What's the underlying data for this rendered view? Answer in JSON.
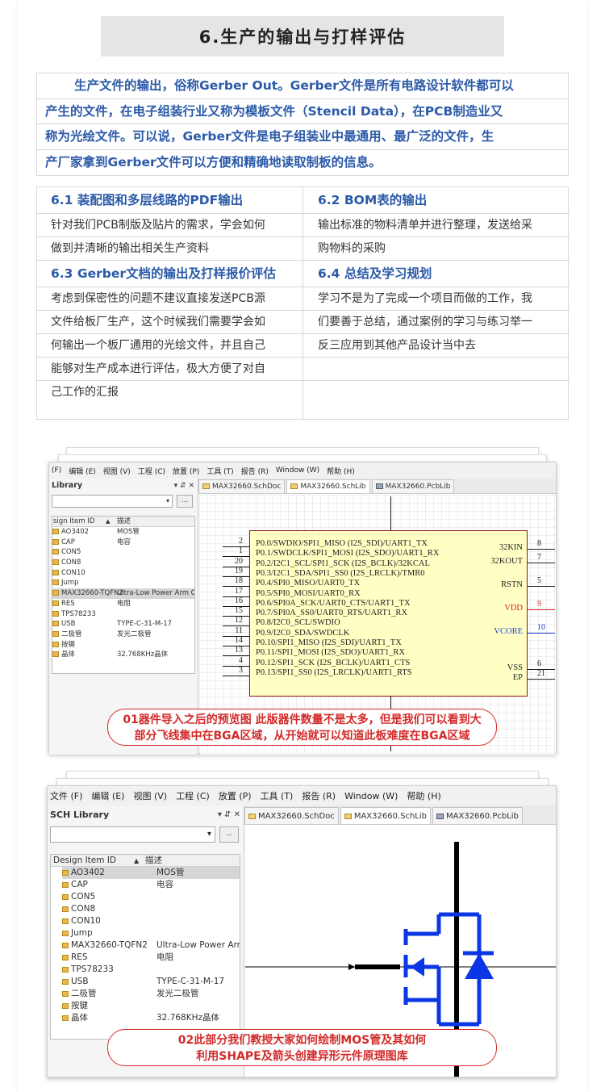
{
  "section_title": "6.生产的输出与打样评估",
  "intro_lines": [
    "生产文件的输出，俗称Gerber Out。Gerber文件是所有电路设计软件都可以",
    "产生的文件，在电子组装行业又称为模板文件（Stencil Data），在PCB制造业又",
    "称为光绘文件。可以说，Gerber文件是电子组装业中最通用、最广泛的文件，生",
    "产厂家拿到Gerber文件可以方便和精确地读取制板的信息。"
  ],
  "grid": {
    "left": [
      {
        "head": "6.1 装配图和多层线路的PDF输出",
        "lines": [
          "针对我们PCB制版及贴片的需求，学会如何",
          "做到并清晰的输出相关生产资料"
        ]
      },
      {
        "head": "6.3 Gerber文档的输出及打样报价评估",
        "lines": [
          "考虑到保密性的问题不建议直接发送PCB源",
          "文件给板厂生产，这个时候我们需要学会如",
          "何输出一个板厂通用的光绘文件，并且自己",
          "能够对生产成本进行评估，极大方便了对自",
          "己工作的汇报"
        ]
      }
    ],
    "right": [
      {
        "head": "6.2 BOM表的输出",
        "lines": [
          "输出标准的物料清单并进行整理，发送给采",
          "购物料的采购"
        ]
      },
      {
        "head": "6.4 总结及学习规划",
        "lines": [
          "学习不是为了完成一个项目而做的工作，我",
          "们要善于总结，通过案例的学习与练习举一",
          "反三应用到其他产品设计当中去"
        ]
      }
    ]
  },
  "screenshot1": {
    "menu": [
      "(F)",
      "编辑 (E)",
      "视图 (V)",
      "工程 (C)",
      "放置 (P)",
      "工具 (T)",
      "报告 (R)",
      "Window (W)",
      "帮助 (H)"
    ],
    "panel_title": "Library",
    "panel_controls": "▾ ⇵ ✕",
    "browse_button": "...",
    "columns": [
      "sign Item ID",
      "描述"
    ],
    "items": [
      {
        "id": "AO3402",
        "desc": "MOS管"
      },
      {
        "id": "CAP",
        "desc": "电容"
      },
      {
        "id": "CON5",
        "desc": ""
      },
      {
        "id": "CON8",
        "desc": ""
      },
      {
        "id": "CON10",
        "desc": ""
      },
      {
        "id": "Jump",
        "desc": ""
      },
      {
        "id": "MAX32660-TQFN2",
        "desc": "Ultra-Low Power Arm Co"
      },
      {
        "id": "RES",
        "desc": "电阻"
      },
      {
        "id": "TPS78233",
        "desc": ""
      },
      {
        "id": "USB",
        "desc": "TYPE-C-31-M-17"
      },
      {
        "id": "二极管",
        "desc": "发光二极管"
      },
      {
        "id": "按键",
        "desc": ""
      },
      {
        "id": "晶体",
        "desc": "32.768KHz晶体"
      }
    ],
    "tabs": [
      "MAX32660.SchDoc",
      "MAX32660.SchLib",
      "MAX32660.PcbLib"
    ],
    "left_pins": [
      {
        "num": "2",
        "label": "P0.0/SWDIO/SPI1_MISO (I2S_SDI)/UART1_TX"
      },
      {
        "num": "1",
        "label": "P0.1/SWDCLK/SPI1_MOSI (I2S_SDO)/UART1_RX"
      },
      {
        "num": "20",
        "label": "P0.2/I2C1_SCL/SPI1_SCK (I2S_BCLK)/32KCAL"
      },
      {
        "num": "19",
        "label": "P0.3/I2C1_SDA/SPI1_SS0 (I2S_LRCLK)/TMR0"
      },
      {
        "num": "18",
        "label": "P0.4/SPI0_MISO/UART0_TX"
      },
      {
        "num": "17",
        "label": "P0.5/SPI0_MOSI/UART0_RX"
      },
      {
        "num": "16",
        "label": "P0.6/SPI0A_SCK/UART0_CTS/UART1_TX"
      },
      {
        "num": "15",
        "label": "P0.7/SPI0A_SS0/UART0_RTS/UART1_RX"
      },
      {
        "num": "12",
        "label": "P0.8/I2C0_SCL/SWDIO"
      },
      {
        "num": "11",
        "label": "P0.9/I2C0_SDA/SWDCLK"
      },
      {
        "num": "14",
        "label": "P0.10/SPI1_MISO (I2S_SDI)/UART1_TX"
      },
      {
        "num": "13",
        "label": "P0.11/SPI1_MOSI (I2S_SDO)/UART1_RX"
      },
      {
        "num": "4",
        "label": "P0.12/SPI1_SCK (I2S_BCLK)/UART1_CTS"
      },
      {
        "num": "3",
        "label": "P0.13/SPI1_SS0 (I2S_LRCLK)/UART1_RTS"
      }
    ],
    "right_pins": [
      {
        "num": "8",
        "label": "32KIN",
        "color": "#222222"
      },
      {
        "num": "7",
        "label": "32KOUT",
        "color": "#222222"
      },
      {
        "num": "5",
        "label": "RSTN",
        "color": "#222222"
      },
      {
        "num": "9",
        "label": "VDD",
        "color": "#d42020"
      },
      {
        "num": "10",
        "label": "VCORE",
        "color": "#1f3fd0"
      },
      {
        "num": "6",
        "label": "VSS",
        "color": "#222222"
      },
      {
        "num": "21",
        "label": "EP",
        "color": "#222222"
      }
    ],
    "callout_lines": [
      "01器件导入之后的预览图 此版器件数量不是太多，但是我们可以看到大",
      "部分飞线集中在BGA区域，从开始就可以知道此板难度在BGA区域"
    ]
  },
  "screenshot2": {
    "menu": [
      "文件 (F)",
      "编辑 (E)",
      "视图 (V)",
      "工程 (C)",
      "放置 (P)",
      "工具 (T)",
      "报告 (R)",
      "Window (W)",
      "帮助 (H)"
    ],
    "panel_title": "SCH Library",
    "panel_controls": "▾ ⇵ ✕",
    "browse_button": "...",
    "columns": [
      "Design Item ID",
      "描述"
    ],
    "items": [
      {
        "id": "AO3402",
        "desc": "MOS管"
      },
      {
        "id": "CAP",
        "desc": "电容"
      },
      {
        "id": "CON5",
        "desc": ""
      },
      {
        "id": "CON8",
        "desc": ""
      },
      {
        "id": "CON10",
        "desc": ""
      },
      {
        "id": "Jump",
        "desc": ""
      },
      {
        "id": "MAX32660-TQFN2",
        "desc": "Ultra-Low Power Arm Co"
      },
      {
        "id": "RES",
        "desc": "电阻"
      },
      {
        "id": "TPS78233",
        "desc": ""
      },
      {
        "id": "USB",
        "desc": "TYPE-C-31-M-17"
      },
      {
        "id": "二极管",
        "desc": "发光二极管"
      },
      {
        "id": "按键",
        "desc": ""
      },
      {
        "id": "晶体",
        "desc": "32.768KHz晶体"
      }
    ],
    "tabs": [
      "MAX32660.SchDoc",
      "MAX32660.SchLib",
      "MAX32660.PcbLib"
    ],
    "callout_lines": [
      "02此部分我们教授大家如何绘制MOS管及其如何",
      "利用SHAPE及箭头创建异形元件原理图库"
    ]
  },
  "colors": {
    "accent_blue": "#2b5aa8",
    "callout_red": "#d42a2a",
    "mos_blue": "#0a36e6",
    "ic_fill": "#ffffc4"
  }
}
